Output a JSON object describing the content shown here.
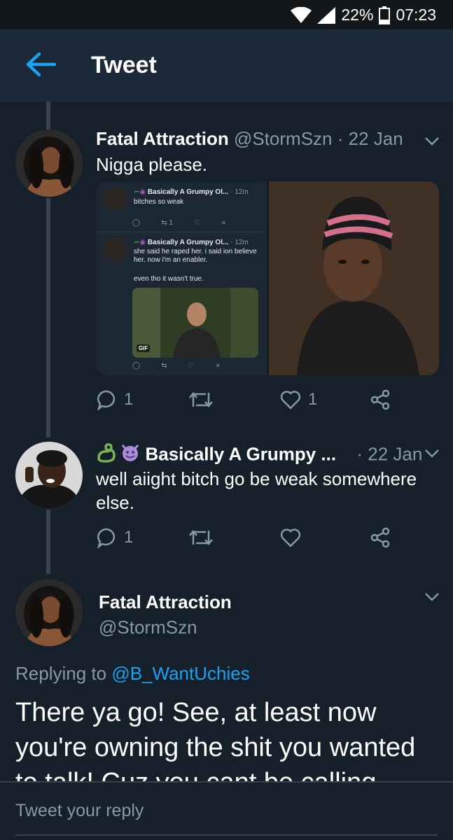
{
  "status_bar": {
    "battery": "22%",
    "time": "07:23"
  },
  "header": {
    "title": "Tweet"
  },
  "tweet1": {
    "name": "Fatal Attraction",
    "handle": "@StormSzn",
    "sep": "·",
    "date": "22 Jan",
    "text": "Nigga please.",
    "replies": "1",
    "likes": "1",
    "embedded": {
      "post1": {
        "name": "Basically A Grumpy Ol...",
        "time": "· 12m",
        "text": "bitches so weak",
        "retweets": "1"
      },
      "post2": {
        "name": "Basically A Grumpy Ol...",
        "time": "· 12m",
        "text_line1": "she said he raped her. i said ion believe",
        "text_line2": "her. now i'm an enabler.",
        "text_line3": "even tho it wasn't true.",
        "gif_label": "GIF"
      }
    }
  },
  "tweet2": {
    "name": "Basically A Grumpy ...",
    "sep": "·",
    "date": "22 Jan",
    "text_line1": "well aiight bitch go be weak somewhere",
    "text_line2": "else.",
    "replies": "1"
  },
  "tweet3": {
    "name": "Fatal Attraction",
    "handle": "@StormSzn",
    "replying_prefix": "Replying to",
    "replying_handle": "@B_WantUchies",
    "text_line1": "There ya go! See, at least now",
    "text_line2": "you're owning the shit you wanted",
    "text_line3": "to talk! Cuz you cant be calling"
  },
  "reply_box": {
    "placeholder": "Tweet your reply"
  },
  "colors": {
    "background": "#15202b",
    "accent": "#1da1f2",
    "muted": "#8899a6",
    "header": "#1c2938"
  }
}
